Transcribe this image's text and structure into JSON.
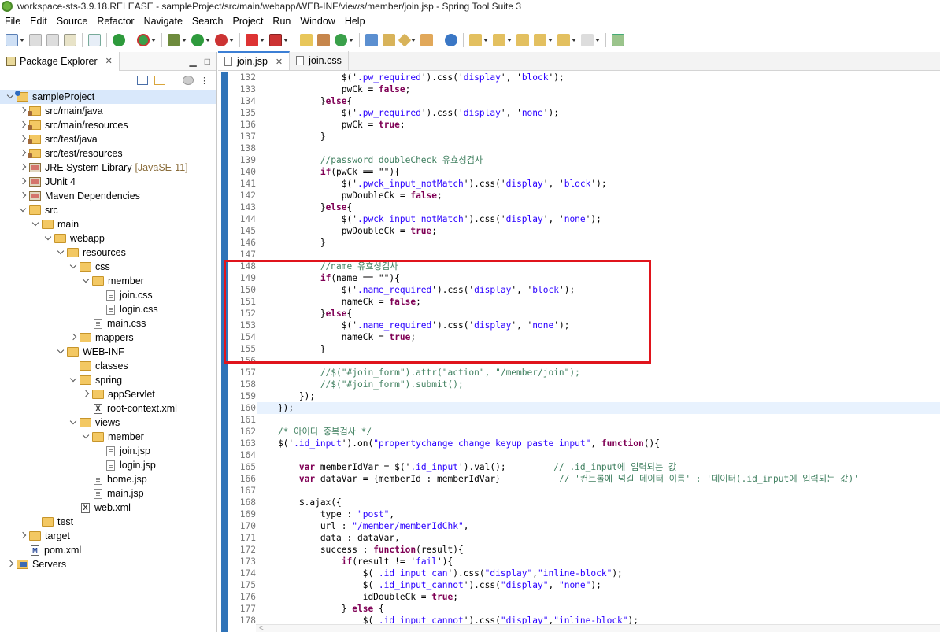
{
  "window": {
    "title": "workspace-sts-3.9.18.RELEASE - sampleProject/src/main/webapp/WEB-INF/views/member/join.jsp - Spring Tool Suite 3"
  },
  "menu": [
    "File",
    "Edit",
    "Source",
    "Refactor",
    "Navigate",
    "Search",
    "Project",
    "Run",
    "Window",
    "Help"
  ],
  "explorer": {
    "title": "Package Explorer",
    "tree": [
      {
        "label": "sampleProject",
        "icon": "project-icon",
        "depth": 0,
        "expanded": true,
        "selected": true
      },
      {
        "label": "src/main/java",
        "icon": "package-folder-icon",
        "depth": 1,
        "expanded": false
      },
      {
        "label": "src/main/resources",
        "icon": "package-folder-icon",
        "depth": 1,
        "expanded": false
      },
      {
        "label": "src/test/java",
        "icon": "package-folder-icon",
        "depth": 1,
        "expanded": false
      },
      {
        "label": "src/test/resources",
        "icon": "package-folder-icon",
        "depth": 1,
        "expanded": false
      },
      {
        "label": "JRE System Library",
        "decoration": "[JavaSE-11]",
        "icon": "library-icon",
        "depth": 1,
        "expanded": false
      },
      {
        "label": "JUnit 4",
        "icon": "library-icon",
        "depth": 1,
        "expanded": false
      },
      {
        "label": "Maven Dependencies",
        "icon": "library-icon",
        "depth": 1,
        "expanded": false
      },
      {
        "label": "src",
        "icon": "folder-icon",
        "depth": 1,
        "expanded": true
      },
      {
        "label": "main",
        "icon": "folder-icon",
        "depth": 2,
        "expanded": true
      },
      {
        "label": "webapp",
        "icon": "folder-icon",
        "depth": 3,
        "expanded": true
      },
      {
        "label": "resources",
        "icon": "folder-icon",
        "depth": 4,
        "expanded": true
      },
      {
        "label": "css",
        "icon": "folder-icon",
        "depth": 5,
        "expanded": true
      },
      {
        "label": "member",
        "icon": "folder-icon",
        "depth": 6,
        "expanded": true
      },
      {
        "label": "join.css",
        "icon": "file-icon",
        "depth": 7
      },
      {
        "label": "login.css",
        "icon": "file-icon",
        "depth": 7
      },
      {
        "label": "main.css",
        "icon": "file-icon",
        "depth": 6
      },
      {
        "label": "mappers",
        "icon": "folder-icon",
        "depth": 5,
        "expanded": false
      },
      {
        "label": "WEB-INF",
        "icon": "folder-icon",
        "depth": 4,
        "expanded": true
      },
      {
        "label": "classes",
        "icon": "folder-icon",
        "depth": 5
      },
      {
        "label": "spring",
        "icon": "folder-icon",
        "depth": 5,
        "expanded": true
      },
      {
        "label": "appServlet",
        "icon": "folder-icon",
        "depth": 6,
        "expanded": false
      },
      {
        "label": "root-context.xml",
        "icon": "xml-file-icon",
        "depth": 6
      },
      {
        "label": "views",
        "icon": "folder-icon",
        "depth": 5,
        "expanded": true
      },
      {
        "label": "member",
        "icon": "folder-icon",
        "depth": 6,
        "expanded": true
      },
      {
        "label": "join.jsp",
        "icon": "file-icon",
        "depth": 7
      },
      {
        "label": "login.jsp",
        "icon": "file-icon",
        "depth": 7
      },
      {
        "label": "home.jsp",
        "icon": "file-icon",
        "depth": 6
      },
      {
        "label": "main.jsp",
        "icon": "file-icon",
        "depth": 6
      },
      {
        "label": "web.xml",
        "icon": "xml-file-icon",
        "depth": 5
      },
      {
        "label": "test",
        "icon": "folder-icon",
        "depth": 2
      },
      {
        "label": "target",
        "icon": "folder-icon",
        "depth": 1,
        "expanded": false
      },
      {
        "label": "pom.xml",
        "icon": "maven-file-icon",
        "depth": 1
      },
      {
        "label": "Servers",
        "icon": "servers-folder-icon",
        "depth": 0,
        "expanded": false
      }
    ]
  },
  "editor": {
    "tabs": [
      {
        "label": "join.jsp",
        "active": true
      },
      {
        "label": "join.css",
        "active": false
      }
    ],
    "current_line": 160,
    "lines": [
      {
        "n": "132",
        "parts": [
          [
            "p",
            "                $('"
          ],
          [
            "s",
            ".pw_required"
          ],
          [
            "p",
            "').css('"
          ],
          [
            "s",
            "display"
          ],
          [
            "p",
            "', '"
          ],
          [
            "s",
            "block"
          ],
          [
            "p",
            "');"
          ]
        ]
      },
      {
        "n": "133",
        "parts": [
          [
            "p",
            "                pwCk = "
          ],
          [
            "k",
            "false"
          ],
          [
            "p",
            ";"
          ]
        ]
      },
      {
        "n": "134",
        "parts": [
          [
            "p",
            "            }"
          ],
          [
            "k",
            "else"
          ],
          [
            "p",
            "{"
          ]
        ]
      },
      {
        "n": "135",
        "parts": [
          [
            "p",
            "                $('"
          ],
          [
            "s",
            ".pw_required"
          ],
          [
            "p",
            "').css('"
          ],
          [
            "s",
            "display"
          ],
          [
            "p",
            "', '"
          ],
          [
            "s",
            "none"
          ],
          [
            "p",
            "');"
          ]
        ]
      },
      {
        "n": "136",
        "parts": [
          [
            "p",
            "                pwCk = "
          ],
          [
            "k",
            "true"
          ],
          [
            "p",
            ";"
          ]
        ]
      },
      {
        "n": "137",
        "parts": [
          [
            "p",
            "            }"
          ]
        ]
      },
      {
        "n": "138",
        "parts": [
          [
            "p",
            ""
          ]
        ]
      },
      {
        "n": "139",
        "parts": [
          [
            "c",
            "            //password doubleCheck 유효성검사"
          ]
        ]
      },
      {
        "n": "140",
        "parts": [
          [
            "p",
            "            "
          ],
          [
            "k",
            "if"
          ],
          [
            "p",
            "(pwCk == \"\"){"
          ]
        ]
      },
      {
        "n": "141",
        "parts": [
          [
            "p",
            "                $('"
          ],
          [
            "s",
            ".pwck_input_notMatch"
          ],
          [
            "p",
            "').css('"
          ],
          [
            "s",
            "display"
          ],
          [
            "p",
            "', '"
          ],
          [
            "s",
            "block"
          ],
          [
            "p",
            "');"
          ]
        ]
      },
      {
        "n": "142",
        "parts": [
          [
            "p",
            "                pwDoubleCk = "
          ],
          [
            "k",
            "false"
          ],
          [
            "p",
            ";"
          ]
        ]
      },
      {
        "n": "143",
        "parts": [
          [
            "p",
            "            }"
          ],
          [
            "k",
            "else"
          ],
          [
            "p",
            "{"
          ]
        ]
      },
      {
        "n": "144",
        "parts": [
          [
            "p",
            "                $('"
          ],
          [
            "s",
            ".pwck_input_notMatch"
          ],
          [
            "p",
            "').css('"
          ],
          [
            "s",
            "display"
          ],
          [
            "p",
            "', '"
          ],
          [
            "s",
            "none"
          ],
          [
            "p",
            "');"
          ]
        ]
      },
      {
        "n": "145",
        "parts": [
          [
            "p",
            "                pwDoubleCk = "
          ],
          [
            "k",
            "true"
          ],
          [
            "p",
            ";"
          ]
        ]
      },
      {
        "n": "146",
        "parts": [
          [
            "p",
            "            }"
          ]
        ]
      },
      {
        "n": "147",
        "parts": [
          [
            "p",
            ""
          ]
        ]
      },
      {
        "n": "148",
        "parts": [
          [
            "c",
            "            //name 유효성검사"
          ]
        ]
      },
      {
        "n": "149",
        "parts": [
          [
            "p",
            "            "
          ],
          [
            "k",
            "if"
          ],
          [
            "p",
            "(name == \"\"){"
          ]
        ]
      },
      {
        "n": "150",
        "parts": [
          [
            "p",
            "                $('"
          ],
          [
            "s",
            ".name_required"
          ],
          [
            "p",
            "').css('"
          ],
          [
            "s",
            "display"
          ],
          [
            "p",
            "', '"
          ],
          [
            "s",
            "block"
          ],
          [
            "p",
            "');"
          ]
        ]
      },
      {
        "n": "151",
        "parts": [
          [
            "p",
            "                nameCk = "
          ],
          [
            "k",
            "false"
          ],
          [
            "p",
            ";"
          ]
        ]
      },
      {
        "n": "152",
        "parts": [
          [
            "p",
            "            }"
          ],
          [
            "k",
            "else"
          ],
          [
            "p",
            "{"
          ]
        ]
      },
      {
        "n": "153",
        "parts": [
          [
            "p",
            "                $('"
          ],
          [
            "s",
            ".name_required"
          ],
          [
            "p",
            "').css('"
          ],
          [
            "s",
            "display"
          ],
          [
            "p",
            "', '"
          ],
          [
            "s",
            "none"
          ],
          [
            "p",
            "');"
          ]
        ]
      },
      {
        "n": "154",
        "parts": [
          [
            "p",
            "                nameCk = "
          ],
          [
            "k",
            "true"
          ],
          [
            "p",
            ";"
          ]
        ]
      },
      {
        "n": "155",
        "parts": [
          [
            "p",
            "            }"
          ]
        ]
      },
      {
        "n": "156",
        "parts": [
          [
            "p",
            ""
          ]
        ]
      },
      {
        "n": "157",
        "parts": [
          [
            "c",
            "            //$(\"#join_form\").attr(\"action\", \"/member/join\");"
          ]
        ]
      },
      {
        "n": "158",
        "parts": [
          [
            "c",
            "            //$(\"#join_form\").submit();"
          ]
        ]
      },
      {
        "n": "159",
        "parts": [
          [
            "p",
            "        });"
          ]
        ]
      },
      {
        "n": "160",
        "parts": [
          [
            "p",
            "    });"
          ]
        ]
      },
      {
        "n": "161",
        "parts": [
          [
            "p",
            ""
          ]
        ]
      },
      {
        "n": "162",
        "parts": [
          [
            "c",
            "    /* 아이디 중복검사 */"
          ]
        ]
      },
      {
        "n": "163",
        "parts": [
          [
            "p",
            "    $('"
          ],
          [
            "s",
            ".id_input"
          ],
          [
            "p",
            "').on("
          ],
          [
            "s",
            "\"propertychange change keyup paste input\""
          ],
          [
            "p",
            ", "
          ],
          [
            "k",
            "function"
          ],
          [
            "p",
            "(){"
          ]
        ]
      },
      {
        "n": "164",
        "parts": [
          [
            "p",
            ""
          ]
        ]
      },
      {
        "n": "165",
        "parts": [
          [
            "p",
            "        "
          ],
          [
            "k",
            "var"
          ],
          [
            "p",
            " memberIdVar = $('"
          ],
          [
            "s",
            ".id_input"
          ],
          [
            "p",
            "').val();         "
          ],
          [
            "c",
            "// .id_input에 입력되는 값"
          ]
        ]
      },
      {
        "n": "166",
        "parts": [
          [
            "p",
            "        "
          ],
          [
            "k",
            "var"
          ],
          [
            "p",
            " dataVar = {memberId : memberIdVar}           "
          ],
          [
            "c",
            "// '컨트롤에 넘길 데이터 이름' : '데이터(.id_input에 입력되는 값)'"
          ]
        ]
      },
      {
        "n": "167",
        "parts": [
          [
            "p",
            ""
          ]
        ]
      },
      {
        "n": "168",
        "parts": [
          [
            "p",
            "        $.ajax({"
          ]
        ]
      },
      {
        "n": "169",
        "parts": [
          [
            "p",
            "            type : "
          ],
          [
            "s",
            "\"post\""
          ],
          [
            "p",
            ","
          ]
        ]
      },
      {
        "n": "170",
        "parts": [
          [
            "p",
            "            url : "
          ],
          [
            "s",
            "\"/member/memberIdChk\""
          ],
          [
            "p",
            ","
          ]
        ]
      },
      {
        "n": "171",
        "parts": [
          [
            "p",
            "            data : dataVar,"
          ]
        ]
      },
      {
        "n": "172",
        "parts": [
          [
            "p",
            "            success : "
          ],
          [
            "k",
            "function"
          ],
          [
            "p",
            "(result){"
          ]
        ]
      },
      {
        "n": "173",
        "parts": [
          [
            "p",
            "                "
          ],
          [
            "k",
            "if"
          ],
          [
            "p",
            "(result != '"
          ],
          [
            "s",
            "fail"
          ],
          [
            "p",
            "'){"
          ]
        ]
      },
      {
        "n": "174",
        "parts": [
          [
            "p",
            "                    $('"
          ],
          [
            "s",
            ".id_input_can"
          ],
          [
            "p",
            "').css("
          ],
          [
            "s",
            "\"display\""
          ],
          [
            "p",
            ","
          ],
          [
            "s",
            "\"inline-block\""
          ],
          [
            "p",
            ");"
          ]
        ]
      },
      {
        "n": "175",
        "parts": [
          [
            "p",
            "                    $('"
          ],
          [
            "s",
            ".id_input_cannot"
          ],
          [
            "p",
            "').css("
          ],
          [
            "s",
            "\"display\""
          ],
          [
            "p",
            ", "
          ],
          [
            "s",
            "\"none\""
          ],
          [
            "p",
            ");"
          ]
        ]
      },
      {
        "n": "176",
        "parts": [
          [
            "p",
            "                    idDoubleCk = "
          ],
          [
            "k",
            "true"
          ],
          [
            "p",
            ";"
          ]
        ]
      },
      {
        "n": "177",
        "parts": [
          [
            "p",
            "                } "
          ],
          [
            "k",
            "else"
          ],
          [
            "p",
            " {"
          ]
        ]
      },
      {
        "n": "178",
        "parts": [
          [
            "p",
            "                    $('"
          ],
          [
            "s",
            ".id_input_cannot"
          ],
          [
            "p",
            "').css("
          ],
          [
            "s",
            "\"display\""
          ],
          [
            "p",
            ","
          ],
          [
            "s",
            "\"inline-block\""
          ],
          [
            "p",
            ");"
          ]
        ]
      }
    ]
  },
  "annotation": {
    "color": "#e0141c"
  }
}
